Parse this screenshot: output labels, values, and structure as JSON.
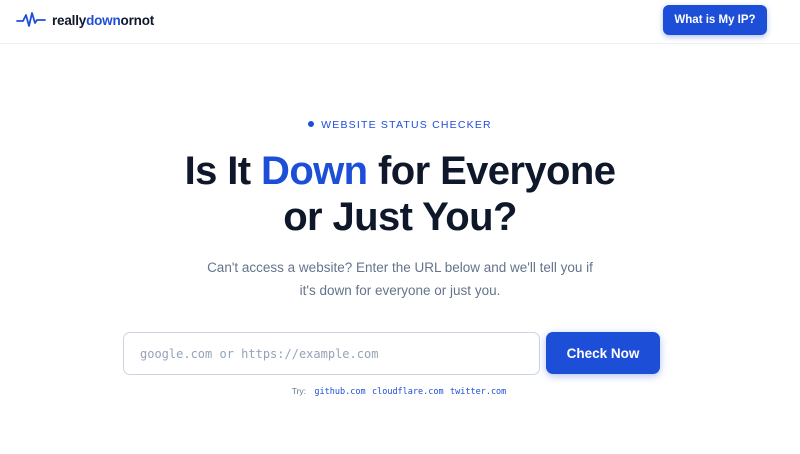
{
  "header": {
    "logo_prefix": "really",
    "logo_accent": "down",
    "logo_suffix": "ornot",
    "ip_button_label": "What is My IP?"
  },
  "hero": {
    "eyebrow": "WEBSITE STATUS CHECKER",
    "title_part1": "Is It ",
    "title_accent": "Down",
    "title_part2": " for Everyone",
    "title_line2": "or Just You?",
    "subtitle_line1": "Can't access a website? Enter the URL below and we'll tell you if",
    "subtitle_line2": "it's down for everyone or just you."
  },
  "search": {
    "placeholder": "google.com or https://example.com",
    "value": "",
    "button_label": "Check Now",
    "try_label": "Try:",
    "suggestions": [
      "github.com",
      "cloudflare.com",
      "twitter.com"
    ]
  },
  "colors": {
    "accent": "#1d4ed8",
    "text_dark": "#0f172a",
    "text_muted": "#64748b"
  },
  "icons": {
    "logo": "pulse-icon"
  }
}
